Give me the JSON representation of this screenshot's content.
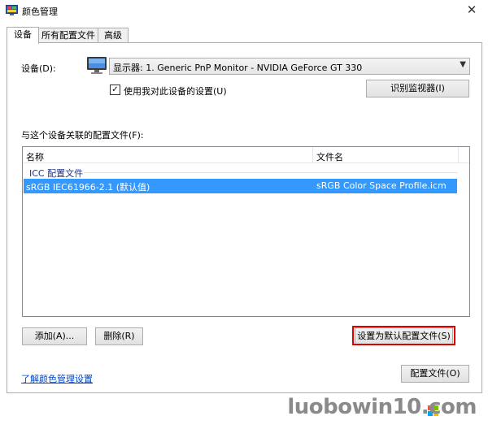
{
  "window": {
    "title": "颜色管理",
    "close_glyph": "✕"
  },
  "tabs": [
    {
      "label": "设备",
      "active": true
    },
    {
      "label": "所有配置文件",
      "active": false
    },
    {
      "label": "高级",
      "active": false
    }
  ],
  "device": {
    "label": "设备(D):",
    "selected": "显示器: 1. Generic PnP Monitor - NVIDIA GeForce GT 330",
    "use_settings_checkbox": {
      "label": "使用我对此设备的设置(U)",
      "checked": true
    },
    "identify_button": "识别监视器(I)"
  },
  "profiles": {
    "label": "与这个设备关联的配置文件(F):",
    "columns": [
      "名称",
      "文件名"
    ],
    "group": "ICC 配置文件",
    "rows": [
      {
        "name": "sRGB IEC61966-2.1 (默认值)",
        "file": "sRGB Color Space Profile.icm",
        "selected": true
      }
    ]
  },
  "buttons": {
    "add": "添加(A)...",
    "remove": "删除(R)",
    "set_default": "设置为默认配置文件(S)",
    "profiles": "配置文件(O)"
  },
  "link": "了解颜色管理设置",
  "watermark": "luobowin10.com",
  "colors": {
    "selection": "#3399ff",
    "highlight_border": "#e00000",
    "link": "#0046c8"
  }
}
